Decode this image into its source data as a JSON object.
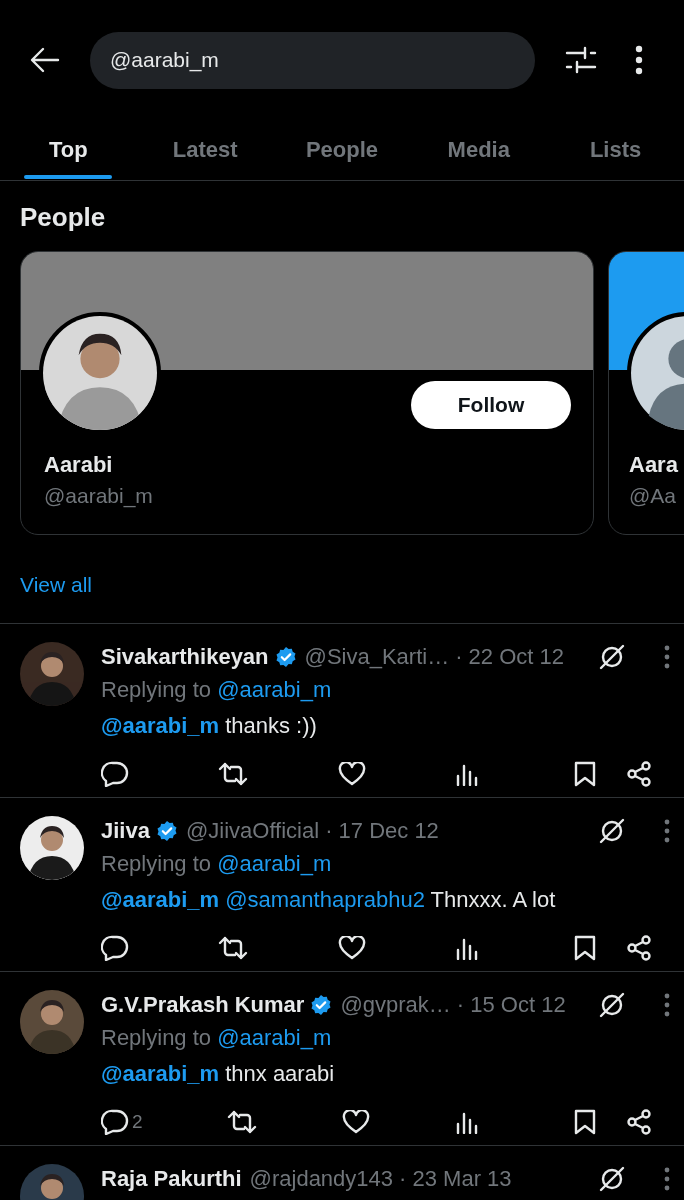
{
  "search": {
    "value": "@aarabi_m"
  },
  "tabs": [
    {
      "label": "Top",
      "selected": true
    },
    {
      "label": "Latest",
      "selected": false
    },
    {
      "label": "People",
      "selected": false
    },
    {
      "label": "Media",
      "selected": false
    },
    {
      "label": "Lists",
      "selected": false
    }
  ],
  "people": {
    "title": "People",
    "view_all": "View all",
    "cards": [
      {
        "name": "Aarabi",
        "handle": "@aarabi_m",
        "color": "#808080",
        "follow": "Follow",
        "kind": "picture"
      },
      {
        "name": "Aara",
        "handle": "@Aa",
        "color": "#1d9bf0",
        "kind": "default"
      }
    ]
  },
  "tweets": [
    {
      "name": "Sivakarthikeyan",
      "verified": true,
      "handle": "@Siva_Karti…",
      "time": "· 22 Oct 12",
      "replying_label": "Replying to",
      "replying_to": "@aarabi_m",
      "mentions": [
        "@aarabi_m"
      ],
      "text": "thanks :))"
    },
    {
      "name": "Jiiva",
      "verified": true,
      "handle": "@JiivaOfficial",
      "time": "· 17 Dec 12",
      "replying_label": "Replying to",
      "replying_to": "@aarabi_m",
      "mentions": [
        "@aarabi_m",
        "@samanthaprabhu2"
      ],
      "text": "Thnxxx. A lot"
    },
    {
      "name": "G.V.Prakash Kumar",
      "verified": true,
      "handle": "@gvprak…",
      "time": "· 15 Oct 12",
      "replying_label": "Replying to",
      "replying_to": "@aarabi_m",
      "mentions": [
        "@aarabi_m"
      ],
      "text": "thnx aarabi",
      "reply_count": "2"
    },
    {
      "name": "Raja Pakurthi",
      "verified": false,
      "handle": "@rajdandy143",
      "time": "· 23 Mar 13"
    }
  ]
}
